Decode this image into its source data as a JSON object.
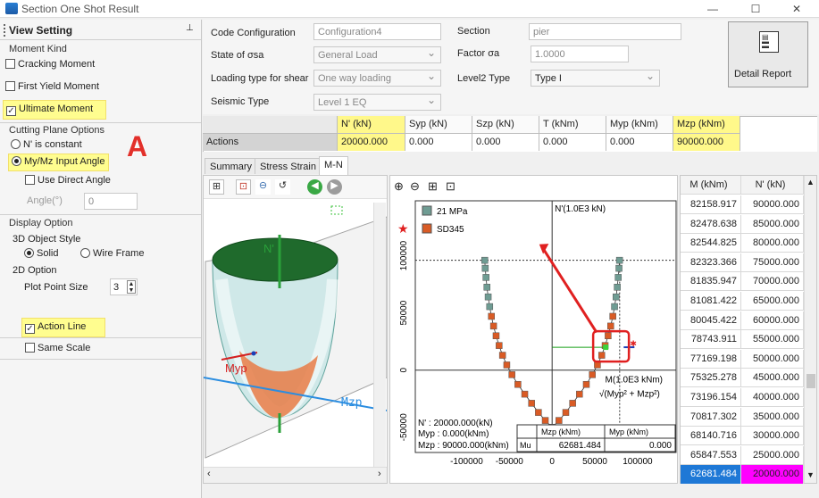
{
  "window": {
    "title": "Section One Shot Result",
    "minimize": "—",
    "maximize": "☐",
    "close": "✕"
  },
  "left": {
    "title": "View Setting",
    "pin": "📌",
    "moment_kind": "Moment Kind",
    "cracking": "Cracking Moment",
    "first_yield": "First Yield Moment",
    "ultimate": "Ultimate Moment",
    "cutting": "Cutting Plane Options",
    "n_const": "N' is constant",
    "mymz": "My/Mz Input Angle",
    "use_direct": "Use Direct Angle",
    "angle_label": "Angle(°)",
    "angle_value": "0",
    "display": "Display Option",
    "object_style": "3D Object Style",
    "solid": "Solid",
    "wire": "Wire Frame",
    "option2d": "2D Option",
    "plot_size": "Plot Point Size",
    "plot_size_value": "3",
    "action_line": "Action Line",
    "same_scale": "Same Scale",
    "annotation": "A"
  },
  "form": {
    "code_label": "Code Configuration",
    "code_value": "Configuration4",
    "section_label": "Section",
    "section_value": "pier",
    "state_label": "State of σsa",
    "state_value": "General Load",
    "factor_label": "Factor σa",
    "factor_value": "1.0000",
    "loading_label": "Loading type for shear",
    "loading_value": "One way loading",
    "level2_label": "Level2 Type",
    "level2_value": "Type I",
    "seismic_label": "Seismic Type",
    "seismic_value": "Level 1 EQ",
    "detail_report": "Detail Report"
  },
  "actions": {
    "headers": [
      "N' (kN)",
      "Syp (kN)",
      "Szp (kN)",
      "T (kNm)",
      "Myp (kNm)",
      "Mzp (kNm)"
    ],
    "row_label": "Actions",
    "values": [
      "20000.000",
      "0.000",
      "0.000",
      "0.000",
      "0.000",
      "90000.000"
    ]
  },
  "tabs": [
    "Summary",
    "Stress Strain",
    "M-N"
  ],
  "plot3d": {
    "n_label": "N'",
    "myp_label": "Myp",
    "mzp_label": "Mzp"
  },
  "chart_data": {
    "type": "scatter",
    "series": [
      {
        "name": "21 MPa",
        "color": "#6f9c93"
      },
      {
        "name": "SD345",
        "color": "#d95b25"
      }
    ],
    "ylabel": "N'(1.0E3 kN)",
    "xlabel": "M(1.0E3 kNm)",
    "xlabel_formula": "√(Myp² + Mzp²)",
    "x_ticks": [
      "-100000",
      "-50000",
      "0",
      "50000",
      "100000"
    ],
    "y_ticks": [
      "100000",
      "50000",
      "0",
      "-50000"
    ],
    "xlim": [
      -160000,
      145000
    ],
    "ylim": [
      -72000,
      148000
    ],
    "curve_right": [
      [
        0,
        -50000
      ],
      [
        8000,
        -44000
      ],
      [
        16000,
        -37000
      ],
      [
        24000,
        -29000
      ],
      [
        32000,
        -21000
      ],
      [
        40000,
        -12500
      ],
      [
        47000,
        -4000
      ],
      [
        53000,
        4500
      ],
      [
        58000,
        13000
      ],
      [
        62000,
        21500
      ],
      [
        65500,
        30000
      ],
      [
        68500,
        38500
      ],
      [
        71000,
        47000
      ],
      [
        73000,
        55500
      ],
      [
        74800,
        64000
      ],
      [
        76200,
        72500
      ],
      [
        77300,
        81000
      ],
      [
        78200,
        89000
      ],
      [
        78800,
        96000
      ]
    ],
    "action_point": [
      90000,
      20000
    ],
    "readout": {
      "n": "N' : 20000.000(kN)",
      "myp": "Myp : 0.000(kNm)",
      "mzp": "Mzp : 90000.000(kNm)",
      "mu_label": "Mu",
      "head_mzp": "Mzp (kNm)",
      "head_myp": "Myp (kNm)",
      "mu_mzp": "62681.484",
      "mu_myp": "0.000"
    }
  },
  "mn_table": {
    "headers": [
      "M (kNm)",
      "N' (kN)"
    ],
    "rows": [
      [
        "82158.917",
        "90000.000"
      ],
      [
        "82478.638",
        "85000.000"
      ],
      [
        "82544.825",
        "80000.000"
      ],
      [
        "82323.366",
        "75000.000"
      ],
      [
        "81835.947",
        "70000.000"
      ],
      [
        "81081.422",
        "65000.000"
      ],
      [
        "80045.422",
        "60000.000"
      ],
      [
        "78743.911",
        "55000.000"
      ],
      [
        "77169.198",
        "50000.000"
      ],
      [
        "75325.278",
        "45000.000"
      ],
      [
        "73196.154",
        "40000.000"
      ],
      [
        "70817.302",
        "35000.000"
      ],
      [
        "68140.716",
        "30000.000"
      ],
      [
        "65847.553",
        "25000.000"
      ],
      [
        "62681.484",
        "20000.000"
      ]
    ]
  }
}
